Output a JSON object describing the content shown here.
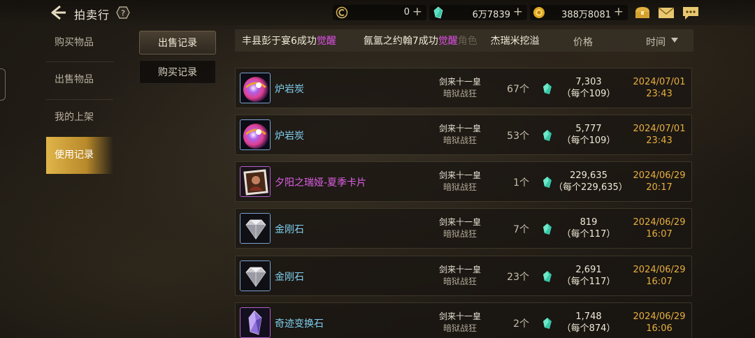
{
  "header": {
    "title": "拍卖行",
    "help_label": "?"
  },
  "currencies": [
    {
      "name": "c-coin",
      "value": "0",
      "color": "#d0b060"
    },
    {
      "name": "gem",
      "value": "6万7839",
      "color": "#40d0b0"
    },
    {
      "name": "gold",
      "value": "388万8081",
      "color": "#e0b030"
    }
  ],
  "top_icons": [
    "chest-icon",
    "mail-icon",
    "chat-icon"
  ],
  "left_nav": {
    "items": [
      {
        "label": "购买物品",
        "active": false
      },
      {
        "label": "出售物品",
        "active": false
      },
      {
        "label": "我的上架",
        "active": false
      },
      {
        "label": "使用记录",
        "active": true
      }
    ]
  },
  "sub_tabs": [
    {
      "label": "出售记录",
      "active": true
    },
    {
      "label": "购买记录",
      "active": false
    }
  ],
  "marquee": {
    "seg1": "丰县彭于宴6成功",
    "hl1": "觉醒",
    "seg2": "氤氲之约翰7成功",
    "hl2": "觉醒",
    "ghost": "角色",
    "seg3": "杰瑞米挖溢"
  },
  "columns": {
    "price": "价格",
    "time": "时间"
  },
  "rows": [
    {
      "name": "炉岩炭",
      "rarity": "blue",
      "icon": "lava-charcoal-icon",
      "seller": "剑来十一皇",
      "server": "暗狱战狂",
      "qty": "67个",
      "price": "7,303",
      "unit": "（每个109）",
      "date": "2024/07/01",
      "clock": "23:43"
    },
    {
      "name": "炉岩炭",
      "rarity": "blue",
      "icon": "lava-charcoal-icon",
      "seller": "剑来十一皇",
      "server": "暗狱战狂",
      "qty": "53个",
      "price": "5,777",
      "unit": "（每个109）",
      "date": "2024/07/01",
      "clock": "23:43"
    },
    {
      "name": "夕阳之瑞娅-夏季卡片",
      "rarity": "purple",
      "icon": "card-icon",
      "seller": "剑来十一皇",
      "server": "暗狱战狂",
      "qty": "1个",
      "price": "229,635",
      "unit": "（每个229,635）",
      "date": "2024/06/29",
      "clock": "20:17"
    },
    {
      "name": "金刚石",
      "rarity": "blue",
      "icon": "diamond-icon",
      "seller": "剑来十一皇",
      "server": "暗狱战狂",
      "qty": "7个",
      "price": "819",
      "unit": "（每个117）",
      "date": "2024/06/29",
      "clock": "16:07"
    },
    {
      "name": "金刚石",
      "rarity": "blue",
      "icon": "diamond-icon",
      "seller": "剑来十一皇",
      "server": "暗狱战狂",
      "qty": "23个",
      "price": "2,691",
      "unit": "（每个117）",
      "date": "2024/06/29",
      "clock": "16:07"
    },
    {
      "name": "奇迹变换石",
      "rarity": "purple",
      "icon": "crystal-icon",
      "seller": "剑来十一皇",
      "server": "暗狱战狂",
      "qty": "2个",
      "price": "1,748",
      "unit": "（每个874）",
      "date": "2024/06/29",
      "clock": "16:06"
    }
  ]
}
